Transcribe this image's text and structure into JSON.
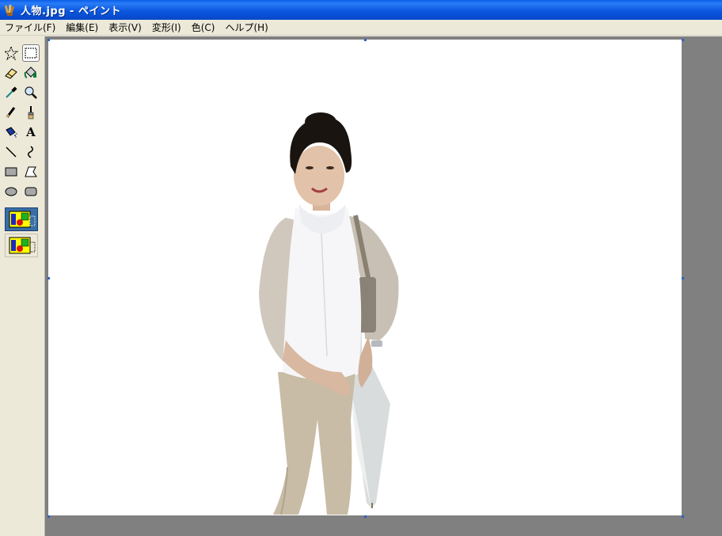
{
  "window": {
    "title": "人物.jpg - ペイント"
  },
  "menu": {
    "items": [
      "ファイル(F)",
      "編集(E)",
      "表示(V)",
      "変形(I)",
      "色(C)",
      "ヘルプ(H)"
    ]
  },
  "tools": [
    {
      "name": "free-select",
      "icon": "star-select-icon"
    },
    {
      "name": "rect-select",
      "icon": "rect-select-icon",
      "selected": true
    },
    {
      "name": "eraser",
      "icon": "eraser-icon"
    },
    {
      "name": "fill",
      "icon": "paint-bucket-icon"
    },
    {
      "name": "pick-color",
      "icon": "eyedropper-icon"
    },
    {
      "name": "magnifier",
      "icon": "magnifier-icon"
    },
    {
      "name": "pencil",
      "icon": "pencil-icon"
    },
    {
      "name": "brush",
      "icon": "brush-icon"
    },
    {
      "name": "airbrush",
      "icon": "airbrush-icon"
    },
    {
      "name": "text",
      "icon": "text-icon",
      "label": "A"
    },
    {
      "name": "line",
      "icon": "line-icon"
    },
    {
      "name": "curve",
      "icon": "curve-icon"
    },
    {
      "name": "rectangle",
      "icon": "rectangle-icon"
    },
    {
      "name": "polygon",
      "icon": "polygon-icon"
    },
    {
      "name": "ellipse",
      "icon": "ellipse-icon"
    },
    {
      "name": "rounded-rectangle",
      "icon": "rounded-rect-icon"
    }
  ],
  "selection_options": [
    {
      "name": "opaque-selection",
      "selected": true
    },
    {
      "name": "transparent-selection",
      "selected": false
    }
  ],
  "colors": {
    "titlebar": "#0a58df",
    "workspace": "#808080",
    "canvas": "#ffffff",
    "chrome": "#ece9d8"
  }
}
